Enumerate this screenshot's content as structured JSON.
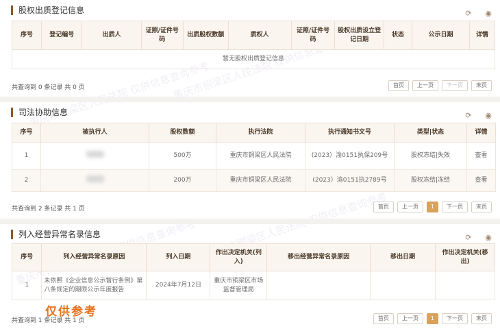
{
  "pledge": {
    "title": "股权出质登记信息",
    "columns": [
      "序号",
      "登记编号",
      "出质人",
      "证照/证件号码",
      "出质股权数额",
      "质权人",
      "证照/证件号码",
      "股权出质设立登记日期",
      "状态",
      "公示日期",
      "详情"
    ],
    "empty_text": "暂无股权出质登记信息",
    "summary": "共查询到 0 条记录 共 0 页",
    "pager": [
      "首页",
      "上一页",
      "下一页",
      "末页"
    ]
  },
  "judicial": {
    "title": "司法协助信息",
    "columns": [
      "序号",
      "被执行人",
      "股权数额",
      "执行法院",
      "执行通知书文号",
      "类型|状态",
      "详情"
    ],
    "rows": [
      {
        "no": "1",
        "amount": "500万",
        "court": "重庆市铜梁区人民法院",
        "doc": "(2023）渝0151执保209号",
        "status": "股权冻结|失效",
        "detail": "查看"
      },
      {
        "no": "2",
        "amount": "200万",
        "court": "重庆市铜梁区人民法院",
        "doc": "(2023）渝0151执2789号",
        "status": "股权冻结|冻结",
        "detail": "查看"
      }
    ],
    "summary": "共查询到 2 条记录 共 1 页",
    "pager": [
      "首页",
      "上一页",
      "1",
      "下一页",
      "末页"
    ]
  },
  "abnormal": {
    "title": "列入经营异常名录信息",
    "columns": [
      "序号",
      "列入经营异常名录原因",
      "列入日期",
      "作出决定机关(列入)",
      "移出经营异常名录原因",
      "移出日期",
      "作出决定机关(移出)"
    ],
    "rows": [
      {
        "no": "1",
        "reason": "未依照《企业信息公示暂行条例》第八条规定的期限公示年度报告",
        "date": "2024年7月12日",
        "authority": "重庆市铜梁区市场监督管理局",
        "out_reason": "",
        "out_date": "",
        "out_authority": ""
      }
    ],
    "summary": "共查询到 1 条记录 共 1 页",
    "pager": [
      "首页",
      "上一页",
      "1",
      "下一页",
      "末页"
    ]
  },
  "stamp_text": "仅供参考",
  "watermark_text": "重庆市铜梁区人民法院 仅供信息查询参考"
}
